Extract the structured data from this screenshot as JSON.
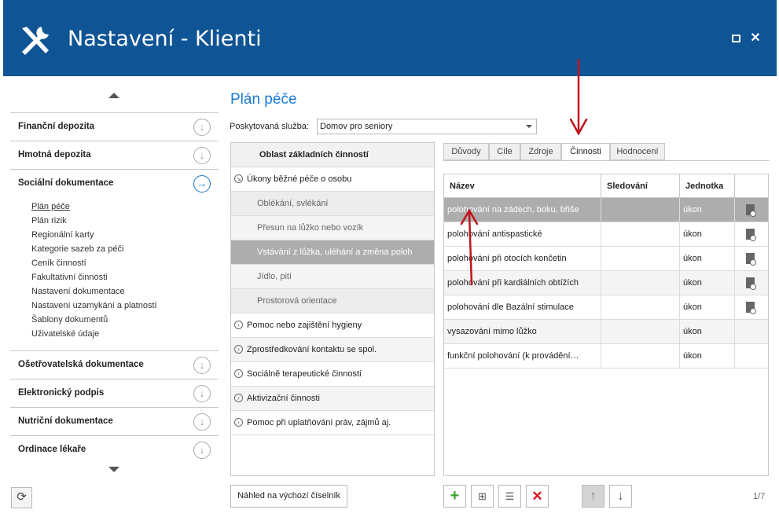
{
  "window": {
    "title": "Nastavení - Klienti"
  },
  "sidebar": {
    "sections_top": [
      {
        "label": "Finanční depozita",
        "icon": "chevron-down-circle-icon"
      },
      {
        "label": "Hmotná depozita",
        "icon": "chevron-down-circle-icon"
      },
      {
        "label": "Sociální dokumentace",
        "icon": "chevron-right-circle-icon",
        "active": true
      }
    ],
    "subitems": [
      "Plán péče",
      "Plán rizik",
      "Regionální karty",
      "Kategorie sazeb za péči",
      "Ceník činností",
      "Fakultativní činnosti",
      "Nastavení dokumentace",
      "Nastavení uzamykání a platností",
      "Šablony dokumentů",
      "Uživatelské údaje"
    ],
    "selected_subitem": "Plán péče",
    "sections_bottom": [
      {
        "label": "Ošetřovatelská dokumentace"
      },
      {
        "label": "Elektronický podpis"
      },
      {
        "label": "Nutriční dokumentace"
      },
      {
        "label": "Ordinace lékaře"
      }
    ]
  },
  "main": {
    "title": "Plán péče",
    "service_label": "Poskytovaná služba:",
    "service_value": "Domov pro seniory",
    "area_header": "Oblast základních činností",
    "area_rows": [
      {
        "label": "Úkony běžné péče o osobu",
        "kind": "cat-open"
      },
      {
        "label": "Oblékání, svlékání",
        "kind": "sub"
      },
      {
        "label": "Přesun na lůžko nebo vozík",
        "kind": "sub"
      },
      {
        "label": "Vstávání z lůžka, uléhání a změna poloh",
        "kind": "sub",
        "selected": true
      },
      {
        "label": "Jídlo, pití",
        "kind": "sub"
      },
      {
        "label": "Prostorová orientace",
        "kind": "sub"
      },
      {
        "label": "Pomoc nebo zajištění hygieny",
        "kind": "cat"
      },
      {
        "label": "Zprostředkování kontaktu se spol.",
        "kind": "cat"
      },
      {
        "label": "Sociálně terapeutické činnosti",
        "kind": "cat"
      },
      {
        "label": "Aktivizační činnosti",
        "kind": "cat"
      },
      {
        "label": "Pomoc při uplatňování práv, zájmů aj.",
        "kind": "cat"
      }
    ],
    "preview_button": "Náhled na výchozí číselník",
    "tabs": [
      "Důvody",
      "Cíle",
      "Zdroje",
      "Činnosti",
      "Hodnocení"
    ],
    "active_tab": "Činnosti",
    "grid": {
      "headers": [
        "Název",
        "Sledování",
        "Jednotka"
      ],
      "rows": [
        {
          "name": "polohování na zádech, boku, břiše",
          "tracking": "",
          "unit": "úkon",
          "doc": true,
          "selected": true
        },
        {
          "name": "polohování antispastické",
          "tracking": "",
          "unit": "úkon",
          "doc": true
        },
        {
          "name": "polohování při otocích končetin",
          "tracking": "",
          "unit": "úkon",
          "doc": true
        },
        {
          "name": "polohování při kardiálních obtížích",
          "tracking": "",
          "unit": "úkon",
          "doc": true
        },
        {
          "name": "polohování dle Bazální stimulace",
          "tracking": "",
          "unit": "úkon",
          "doc": true
        },
        {
          "name": "vysazování mimo lůžko",
          "tracking": "",
          "unit": "úkon",
          "doc": false
        },
        {
          "name": "funkční polohování (k provádění…",
          "tracking": "",
          "unit": "úkon",
          "doc": false
        }
      ]
    },
    "toolbar_icons": [
      "add-icon",
      "add-sub-icon",
      "edit-icon",
      "delete-icon",
      "move-up-icon",
      "move-down-icon"
    ],
    "pager": "1/7"
  },
  "colors": {
    "header_bg": "#0f5495",
    "accent": "#1a7ad1",
    "selected_row": "#adadad",
    "annotation_arrow": "#c0141c"
  }
}
